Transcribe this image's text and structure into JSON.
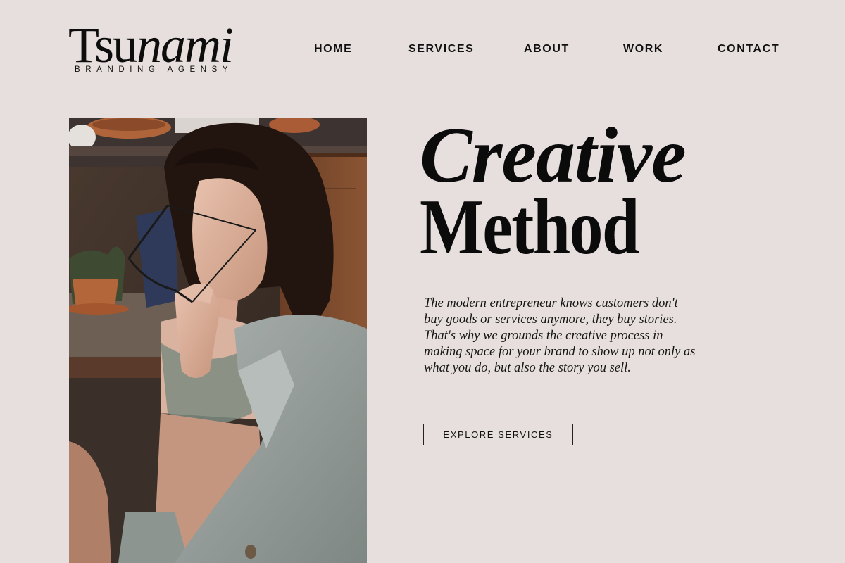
{
  "brand": {
    "name_upright": "Tsu",
    "name_italic": "nami",
    "tagline": "BRANDING AGENSY"
  },
  "nav": {
    "items": [
      {
        "label": "HOME"
      },
      {
        "label": "SERVICES"
      },
      {
        "label": "ABOUT"
      },
      {
        "label": "WORK"
      },
      {
        "label": "CONTACT"
      }
    ]
  },
  "hero": {
    "headline_line1": "Creative",
    "headline_line2": "Method",
    "body_lines": [
      "The modern entrepreneur knows customers don't",
      "buy goods or services anymore, they buy stories.",
      "That's why we grounds the creative process in",
      "making space for your brand to show up not only as",
      "what you do, but also the story you sell."
    ],
    "cta_label": "EXPLORE SERVICES"
  },
  "colors": {
    "background": "#e7dfdd",
    "text": "#111111",
    "cta_border": "#222222"
  }
}
